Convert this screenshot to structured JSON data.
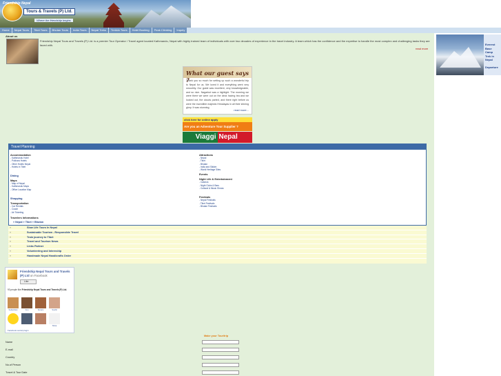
{
  "header": {
    "brand_top": "Friendship Nepal",
    "brand_box": "Tours & Travels (P) Ltd.",
    "tagline": "Where the friendship begins"
  },
  "nav": [
    "Home",
    "Nepal Tours",
    "Tibet Tours",
    "Bhutan Tours",
    "India Tours",
    "Nepal Treks",
    "Trekkin Tours",
    "Hotel Booking",
    "Peak Climbing",
    "Inquiry"
  ],
  "about": {
    "title": "About us",
    "text": "Friendship Nepal Tours and Travels (P) Ltd. is a premier Tour Operator / Travel agent located Kathmandu, Nepal with highly trained team of individuals with over two decades of experience in the travel industry. A team which has the confidence and the expertise to handle the most complex and challenging tasks they are faced with.",
    "read_more": "read more"
  },
  "guest": {
    "heading": "What our guest says ?",
    "text": "Thank you so much for setting up such a wonderful trip to Nepal for us. We loved it and everything went very smoothly. Our guide was excellent, very knowledgeable, and so nice. Nagarkot was a highlight. The morning we were there we were out on the deck having tea and we looked out, the clouds parted, and there right before us were the incredible majestic Himalayas in all their shining glory. It was stunning.",
    "more": "read more..."
  },
  "promos": {
    "online_apply": "click here for online apply",
    "supplier": "Are you an Adventure Tour Supplier ?",
    "viaggi_1": "Viaggi",
    "viaggi_2": "Nepal"
  },
  "travel_planning": {
    "title": "Travel Planning",
    "left": [
      {
        "heading": "Accommodation",
        "links": [
          "- Kathmandu Hotel",
          "- Pokhara Hotels",
          "- Other Hotels Nepal",
          "- Hotels in Tibet"
        ]
      },
      {
        "heading": "Dining",
        "links": []
      },
      {
        "heading": "Maps",
        "links": [
          "- Map of Nepal",
          "- Kathmandu Maps",
          "- Office Location Map"
        ]
      },
      {
        "heading": "Shopping",
        "links": []
      },
      {
        "heading": "Transportation",
        "links": [
          "- Car Rentals",
          "- Coach",
          "- Air Ticketing"
        ]
      }
    ],
    "right": [
      {
        "heading": "Attractions",
        "links": [
          "- Nepal",
          "- Tibet",
          "- Bhutan",
          "- India and Sikkim",
          "- World Heritage Sites"
        ]
      },
      {
        "heading": "Events",
        "links": []
      },
      {
        "heading": "Night Life & Entertainment",
        "links": [
          "- Casinos",
          "- Night Clubs & Bars",
          "- Cultural & Music Shows"
        ]
      },
      {
        "heading": "Festivals",
        "links": [
          "- Nepal Festivals",
          "- Tibet Festivals",
          "- Bhutan Festivals"
        ]
      }
    ],
    "info_title": "Travelers Informations",
    "info_links": "» Nepal » Tibet » Bhutan"
  },
  "links": [
    "Slow Life Tours In Nepal",
    "Sustainable Tourism - Responsible Travel",
    "Train journey to Tibet",
    "Travel and Tourism News",
    "Links Partner",
    "Volunteering and Internship",
    "Handmade Nepal Handicrafts Order"
  ],
  "link_bullet": "»",
  "facebook": {
    "page_name": "Friendship Nepal Tours and Travels (P) Ltd",
    "on_facebook": "on Facebook",
    "like": "Like",
    "count_prefix": "93 people like",
    "count_page": "Friendship Nepal Tours and Travels (P) Ltd.",
    "faces": [
      "Sudarshan",
      "Anu",
      "Sonam",
      "Sushil",
      "Rohit",
      "",
      "",
      "Silvia"
    ],
    "plugin": "Facebook social plugin"
  },
  "form": {
    "title": "Make your Tour/trip",
    "fields": [
      "Name",
      "E-mail",
      "Country",
      "No.of Person",
      "Travel & Tour Date"
    ]
  },
  "side": {
    "caption": "Everest Base Camp Trek in Nepal",
    "departure": "Departure"
  }
}
